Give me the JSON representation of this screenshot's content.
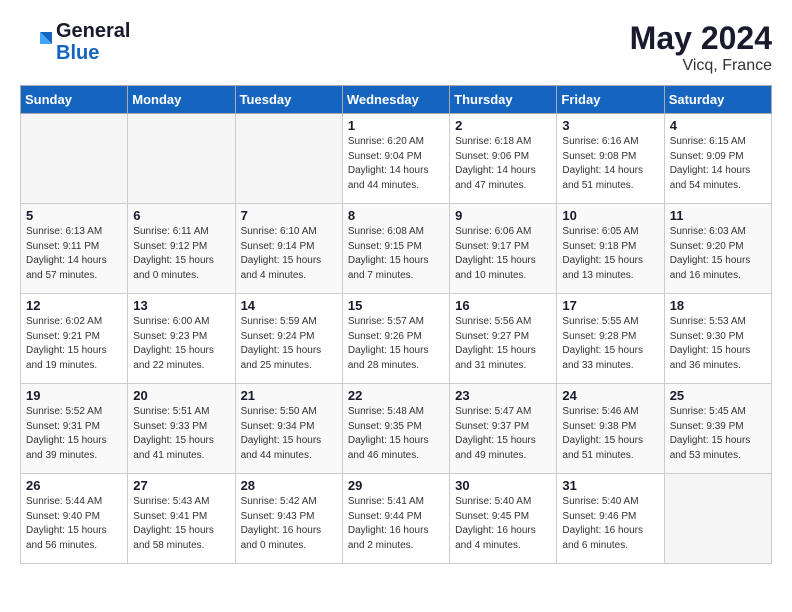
{
  "header": {
    "logo_line1": "General",
    "logo_line2": "Blue",
    "month_year": "May 2024",
    "location": "Vicq, France"
  },
  "days_of_week": [
    "Sunday",
    "Monday",
    "Tuesday",
    "Wednesday",
    "Thursday",
    "Friday",
    "Saturday"
  ],
  "weeks": [
    [
      {
        "day": "",
        "info": ""
      },
      {
        "day": "",
        "info": ""
      },
      {
        "day": "",
        "info": ""
      },
      {
        "day": "1",
        "info": "Sunrise: 6:20 AM\nSunset: 9:04 PM\nDaylight: 14 hours\nand 44 minutes."
      },
      {
        "day": "2",
        "info": "Sunrise: 6:18 AM\nSunset: 9:06 PM\nDaylight: 14 hours\nand 47 minutes."
      },
      {
        "day": "3",
        "info": "Sunrise: 6:16 AM\nSunset: 9:08 PM\nDaylight: 14 hours\nand 51 minutes."
      },
      {
        "day": "4",
        "info": "Sunrise: 6:15 AM\nSunset: 9:09 PM\nDaylight: 14 hours\nand 54 minutes."
      }
    ],
    [
      {
        "day": "5",
        "info": "Sunrise: 6:13 AM\nSunset: 9:11 PM\nDaylight: 14 hours\nand 57 minutes."
      },
      {
        "day": "6",
        "info": "Sunrise: 6:11 AM\nSunset: 9:12 PM\nDaylight: 15 hours\nand 0 minutes."
      },
      {
        "day": "7",
        "info": "Sunrise: 6:10 AM\nSunset: 9:14 PM\nDaylight: 15 hours\nand 4 minutes."
      },
      {
        "day": "8",
        "info": "Sunrise: 6:08 AM\nSunset: 9:15 PM\nDaylight: 15 hours\nand 7 minutes."
      },
      {
        "day": "9",
        "info": "Sunrise: 6:06 AM\nSunset: 9:17 PM\nDaylight: 15 hours\nand 10 minutes."
      },
      {
        "day": "10",
        "info": "Sunrise: 6:05 AM\nSunset: 9:18 PM\nDaylight: 15 hours\nand 13 minutes."
      },
      {
        "day": "11",
        "info": "Sunrise: 6:03 AM\nSunset: 9:20 PM\nDaylight: 15 hours\nand 16 minutes."
      }
    ],
    [
      {
        "day": "12",
        "info": "Sunrise: 6:02 AM\nSunset: 9:21 PM\nDaylight: 15 hours\nand 19 minutes."
      },
      {
        "day": "13",
        "info": "Sunrise: 6:00 AM\nSunset: 9:23 PM\nDaylight: 15 hours\nand 22 minutes."
      },
      {
        "day": "14",
        "info": "Sunrise: 5:59 AM\nSunset: 9:24 PM\nDaylight: 15 hours\nand 25 minutes."
      },
      {
        "day": "15",
        "info": "Sunrise: 5:57 AM\nSunset: 9:26 PM\nDaylight: 15 hours\nand 28 minutes."
      },
      {
        "day": "16",
        "info": "Sunrise: 5:56 AM\nSunset: 9:27 PM\nDaylight: 15 hours\nand 31 minutes."
      },
      {
        "day": "17",
        "info": "Sunrise: 5:55 AM\nSunset: 9:28 PM\nDaylight: 15 hours\nand 33 minutes."
      },
      {
        "day": "18",
        "info": "Sunrise: 5:53 AM\nSunset: 9:30 PM\nDaylight: 15 hours\nand 36 minutes."
      }
    ],
    [
      {
        "day": "19",
        "info": "Sunrise: 5:52 AM\nSunset: 9:31 PM\nDaylight: 15 hours\nand 39 minutes."
      },
      {
        "day": "20",
        "info": "Sunrise: 5:51 AM\nSunset: 9:33 PM\nDaylight: 15 hours\nand 41 minutes."
      },
      {
        "day": "21",
        "info": "Sunrise: 5:50 AM\nSunset: 9:34 PM\nDaylight: 15 hours\nand 44 minutes."
      },
      {
        "day": "22",
        "info": "Sunrise: 5:48 AM\nSunset: 9:35 PM\nDaylight: 15 hours\nand 46 minutes."
      },
      {
        "day": "23",
        "info": "Sunrise: 5:47 AM\nSunset: 9:37 PM\nDaylight: 15 hours\nand 49 minutes."
      },
      {
        "day": "24",
        "info": "Sunrise: 5:46 AM\nSunset: 9:38 PM\nDaylight: 15 hours\nand 51 minutes."
      },
      {
        "day": "25",
        "info": "Sunrise: 5:45 AM\nSunset: 9:39 PM\nDaylight: 15 hours\nand 53 minutes."
      }
    ],
    [
      {
        "day": "26",
        "info": "Sunrise: 5:44 AM\nSunset: 9:40 PM\nDaylight: 15 hours\nand 56 minutes."
      },
      {
        "day": "27",
        "info": "Sunrise: 5:43 AM\nSunset: 9:41 PM\nDaylight: 15 hours\nand 58 minutes."
      },
      {
        "day": "28",
        "info": "Sunrise: 5:42 AM\nSunset: 9:43 PM\nDaylight: 16 hours\nand 0 minutes."
      },
      {
        "day": "29",
        "info": "Sunrise: 5:41 AM\nSunset: 9:44 PM\nDaylight: 16 hours\nand 2 minutes."
      },
      {
        "day": "30",
        "info": "Sunrise: 5:40 AM\nSunset: 9:45 PM\nDaylight: 16 hours\nand 4 minutes."
      },
      {
        "day": "31",
        "info": "Sunrise: 5:40 AM\nSunset: 9:46 PM\nDaylight: 16 hours\nand 6 minutes."
      },
      {
        "day": "",
        "info": ""
      }
    ]
  ]
}
